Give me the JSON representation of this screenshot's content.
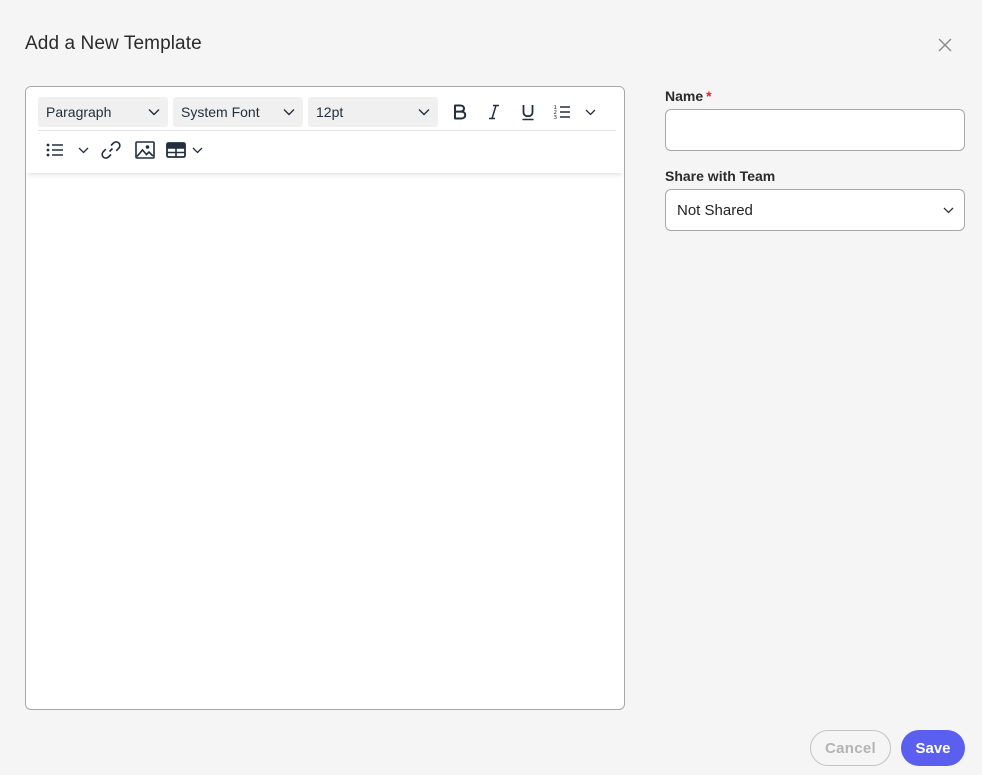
{
  "dialog": {
    "title": "Add a New Template",
    "close_icon": "close-icon"
  },
  "editor": {
    "toolbar": {
      "block_format": "Paragraph",
      "font_family": "System Font",
      "font_size": "12pt",
      "buttons": [
        "bold-icon",
        "italic-icon",
        "underline-icon",
        "numbered-list-icon",
        "bullet-list-icon",
        "link-icon",
        "image-icon",
        "table-icon"
      ]
    },
    "content": ""
  },
  "form": {
    "name_label": "Name",
    "name_required_marker": "*",
    "name_value": "",
    "share_label": "Share with Team",
    "share_value": "Not Shared"
  },
  "actions": {
    "cancel_label": "Cancel",
    "save_label": "Save"
  },
  "colors": {
    "primary": "#5b5fef",
    "required": "#e0222f",
    "border": "#a8a8a8",
    "background": "#f5f5f5"
  }
}
